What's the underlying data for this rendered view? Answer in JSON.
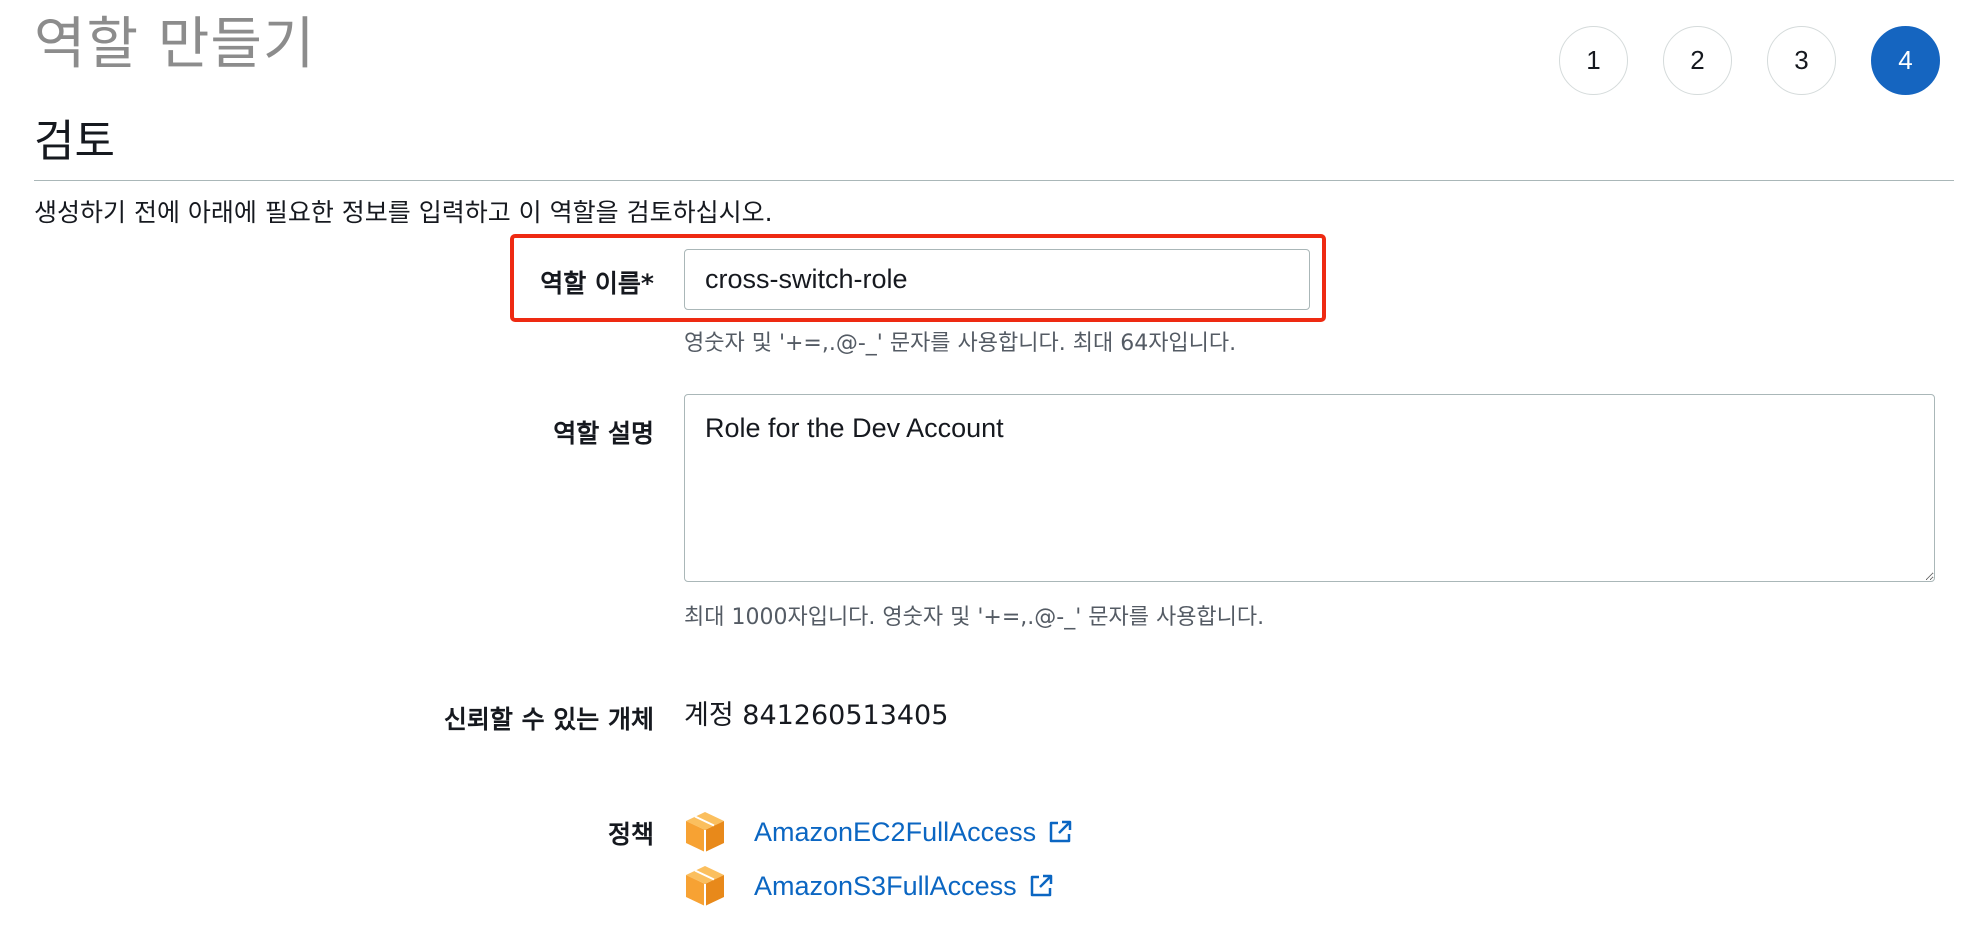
{
  "header": {
    "title": "역할 만들기",
    "steps": [
      "1",
      "2",
      "3",
      "4"
    ],
    "active_step": "4"
  },
  "section": {
    "title": "검토",
    "intro": "생성하기 전에 아래에 필요한 정보를 입력하고 이 역할을 검토하십시오."
  },
  "form": {
    "role_name": {
      "label": "역할 이름*",
      "value": "cross-switch-role",
      "hint": "영숫자 및 '+=,.@-_' 문자를 사용합니다. 최대 64자입니다."
    },
    "role_description": {
      "label": "역할 설명",
      "value": "Role for the Dev Account",
      "hint": "최대 1000자입니다. 영숫자 및 '+=,.@-_' 문자를 사용합니다."
    },
    "trusted_entities": {
      "label": "신뢰할 수 있는 개체",
      "value": "계정 841260513405"
    },
    "policies": {
      "label": "정책",
      "items": [
        {
          "name": "AmazonEC2FullAccess",
          "icon": "policy-box-icon"
        },
        {
          "name": "AmazonS3FullAccess",
          "icon": "policy-box-icon"
        }
      ]
    }
  },
  "colors": {
    "accent": "#1565c0",
    "highlight": "#ee2a12",
    "link": "#0b66c2",
    "policy_icon": "#f7a233"
  }
}
